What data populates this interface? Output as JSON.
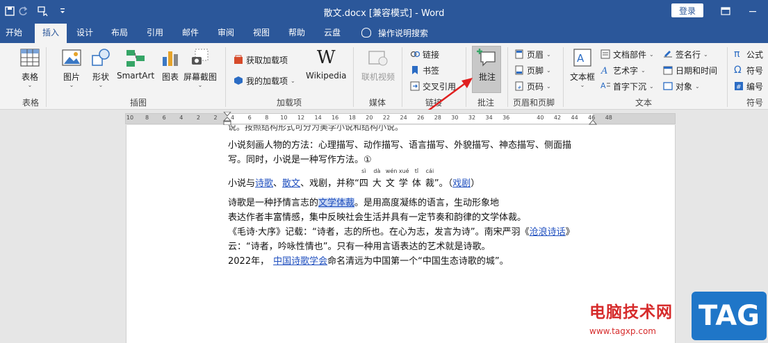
{
  "titlebar": {
    "doc_title": "散文.docx [兼容模式]  -  Word",
    "login_label": "登录"
  },
  "tabs": [
    "开始",
    "插入",
    "设计",
    "布局",
    "引用",
    "邮件",
    "审阅",
    "视图",
    "帮助",
    "云盘"
  ],
  "tell_me": "操作说明搜索",
  "ribbon": {
    "table": {
      "btn": "表格",
      "label": "表格"
    },
    "illustrations": {
      "picture": "图片",
      "shapes": "形状",
      "smartart": "SmartArt",
      "chart": "图表",
      "screenshot": "屏幕截图",
      "label": "插图"
    },
    "addins": {
      "get": "获取加载项",
      "mine": "我的加载项",
      "wiki": "Wikipedia",
      "label": "加载项"
    },
    "media": {
      "online_video": "联机视频",
      "label": "媒体"
    },
    "links": {
      "link": "链接",
      "bookmark": "书签",
      "crossref": "交叉引用",
      "label": "链接"
    },
    "comments": {
      "comment": "批注",
      "label": "批注"
    },
    "header_footer": {
      "header": "页眉",
      "footer": "页脚",
      "page_number": "页码",
      "label": "页眉和页脚"
    },
    "text": {
      "textbox": "文本框",
      "quick_parts": "文档部件",
      "wordart": "艺术字",
      "dropcap": "首字下沉",
      "signature": "签名行",
      "datetime": "日期和时间",
      "object": "对象",
      "label": "文本"
    },
    "symbols": {
      "equation": "公式",
      "symbol": "符号",
      "number": "编号",
      "label": "符号"
    }
  },
  "ruler_ticks": [
    "10",
    "8",
    "6",
    "4",
    "2",
    "2",
    "4",
    "6",
    "8",
    "10",
    "12",
    "14",
    "16",
    "18",
    "20",
    "22",
    "24",
    "26",
    "28",
    "30",
    "32",
    "34",
    "36",
    "40",
    "42",
    "44",
    "46",
    "48"
  ],
  "document": {
    "l1": "小说刻画人物的方法：心理描写、动作描写、语言描写、外貌描写、神态描写、侧面描",
    "l2": "写。同时，小说是一种写作方法。①",
    "l3_a": "小说与",
    "l3_poetry": "诗歌",
    "l3_sep": "、",
    "l3_prose": "散文",
    "l3_b": "、戏剧，并称",
    "l3_quote_open": "“",
    "ruby": [
      {
        "base": "四",
        "pinyin": "sì"
      },
      {
        "base": "大",
        "pinyin": "dà"
      },
      {
        "base": "文",
        "pinyin": "wén"
      },
      {
        "base": "学",
        "pinyin": "xué"
      },
      {
        "base": "体",
        "pinyin": "tǐ"
      },
      {
        "base": "裁",
        "pinyin": "cái"
      }
    ],
    "l3_c": "”。（",
    "l3_drama": "戏剧",
    "l3_d": "）",
    "l4_a": "诗歌是一种抒情言志的",
    "l4_link": "文学体裁",
    "l4_b": "。是用高度凝练的语言，生动形象地",
    "l5": "表达作者丰富情感，集中反映社会生活并具有一定节奏和韵律的文学体裁。",
    "l6_a": "《毛诗·大序》记载：“诗者，志的所也。在心为志，发言为诗”。南宋严羽《",
    "l6_link": "沧浪诗话",
    "l6_b": "》",
    "l7": "云：“诗者，吟咏性情也”。只有一种用言语表达的艺术就是诗歌。",
    "l8_a": "2022年，",
    "l8_link": "中国诗歌学会",
    "l8_b": "命名清远为中国第一个“中国生态诗歌的城”。"
  },
  "watermark": {
    "cn": "电脑技术网",
    "url": "www.tagxp.com",
    "tag": "TAG"
  },
  "colors": {
    "accent": "#2b579a",
    "arrow": "#e02020",
    "link": "#1f4fbf"
  }
}
